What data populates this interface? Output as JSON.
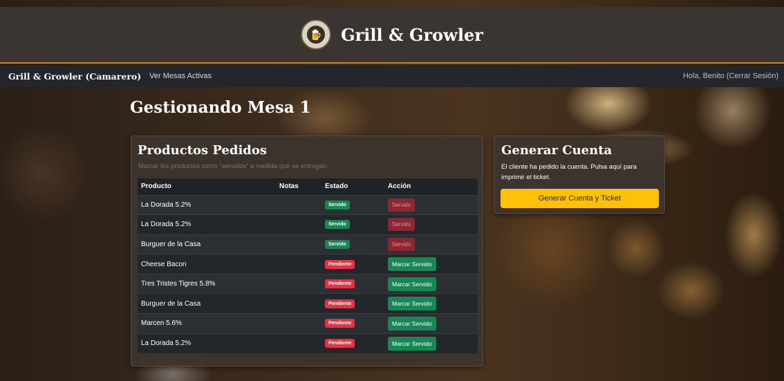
{
  "header": {
    "logo_icon": "growler-logo-icon",
    "title": "Grill & Growler"
  },
  "nav": {
    "brand": "Grill & Growler (Camarero)",
    "active_tables_link": "Ver Mesas Activas",
    "user_greeting": "Hola, Benito (Cerrar Sesión)"
  },
  "page": {
    "title": "Gestionando Mesa 1"
  },
  "products_card": {
    "title": "Productos Pedidos",
    "subtitle": "Marcar los productos como \"servidos\" a medida que se entregan.",
    "columns": [
      "Producto",
      "Notas",
      "Estado",
      "Acción"
    ],
    "rows": [
      {
        "product": "La Dorada 5.2%",
        "notes": "",
        "status": "Servido",
        "action": "Servido"
      },
      {
        "product": "La Dorada 5.2%",
        "notes": "",
        "status": "Servido",
        "action": "Servido"
      },
      {
        "product": "Burguer de la Casa",
        "notes": "",
        "status": "Servido",
        "action": "Servido"
      },
      {
        "product": "Cheese Bacon",
        "notes": "",
        "status": "Pendiente",
        "action": "Marcar Servido"
      },
      {
        "product": "Tres Tristes Tigres 5.8%",
        "notes": "",
        "status": "Pendiente",
        "action": "Marcar Servido"
      },
      {
        "product": "Burguer de la Casa",
        "notes": "",
        "status": "Pendiente",
        "action": "Marcar Servido"
      },
      {
        "product": "Marcen 5.6%",
        "notes": "",
        "status": "Pendiente",
        "action": "Marcar Servido"
      },
      {
        "product": "La Dorada 5.2%",
        "notes": "",
        "status": "Pendiente",
        "action": "Marcar Servido"
      }
    ]
  },
  "bill_card": {
    "title": "Generar Cuenta",
    "description": "El cliente ha pedido la cuenta. Pulsa aquí para imprimir el ticket.",
    "button_label": "Generar Cuenta y Ticket"
  },
  "colors": {
    "header_bg": "#3a3531",
    "accent": "#c8861f",
    "served": "#198754",
    "pending": "#dc3545",
    "generate_button": "#ffc107"
  }
}
